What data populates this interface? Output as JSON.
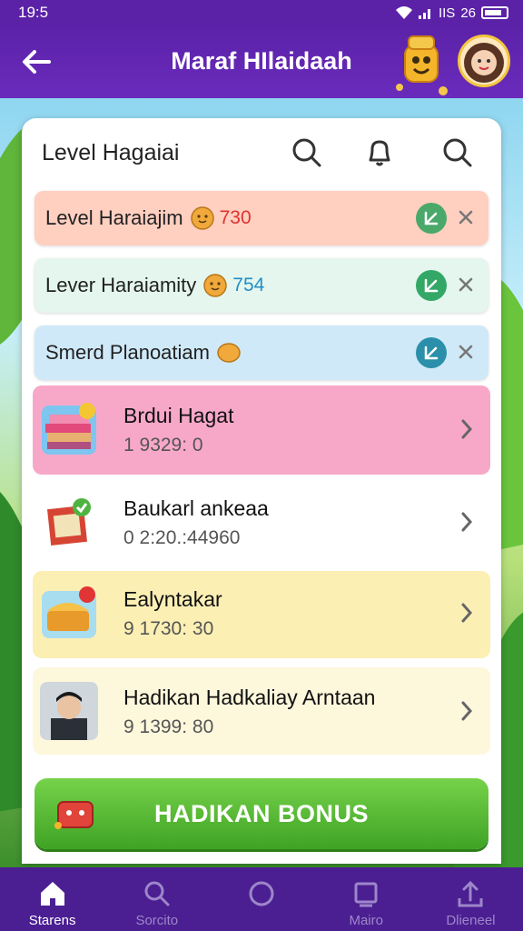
{
  "status_bar": {
    "time": "19:5",
    "right_text": "IIS",
    "battery_text": "26"
  },
  "app_bar": {
    "title": "Maraf HIlaidaah"
  },
  "card": {
    "title": "Level Hagaiai"
  },
  "levels": [
    {
      "label": "Level Haraiajim",
      "value": "730",
      "value_color": "#e0322f",
      "bg": "#ffcfc0",
      "check_color": "#4aa86a"
    },
    {
      "label": "Lever Haraiamity",
      "value": "754",
      "value_color": "#1f8fc7",
      "bg": "#e4f6ee",
      "check_color": "#33a866"
    },
    {
      "label": "Smerd Planoatiam",
      "value": "",
      "value_color": "#222222",
      "bg": "#cfe9f8",
      "check_color": "#2b8faa"
    }
  ],
  "items": [
    {
      "title": "Brdui Hagat",
      "subtitle": "1 9329: 0"
    },
    {
      "title": "Baukarl ankeaa",
      "subtitle": "0 2:20.:44960"
    },
    {
      "title": "Ealyntakar",
      "subtitle": "9 1730: 30"
    },
    {
      "title": "Hadikan Hadkaliay Arntaan",
      "subtitle": "9 1399: 80"
    }
  ],
  "bonus_button": {
    "label": "HADIKAN BONUS"
  },
  "bottom_nav": [
    {
      "label": "Starens",
      "icon": "home-icon",
      "active": true
    },
    {
      "label": "Sorcito",
      "icon": "search-icon",
      "active": false
    },
    {
      "label": "",
      "icon": "circle-icon",
      "active": false
    },
    {
      "label": "Mairo",
      "icon": "square-icon",
      "active": false
    },
    {
      "label": "Dlieneel",
      "icon": "upload-icon",
      "active": false
    }
  ],
  "colors": {
    "brand_purple": "#5b22a8",
    "bonus_green": "#4cb52f",
    "pink_item": "#f7a8c8",
    "yellow_item": "#fcefb4"
  }
}
